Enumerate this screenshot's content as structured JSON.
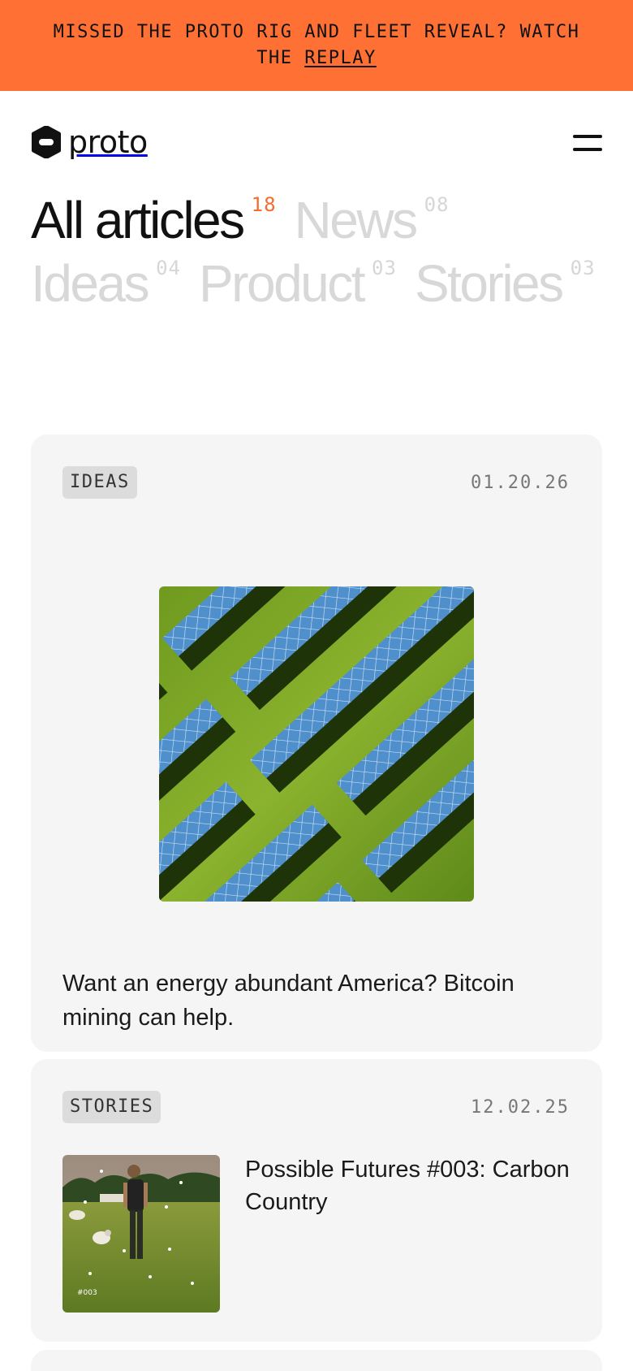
{
  "banner": {
    "text": "MISSED THE PROTO RIG AND FLEET REVEAL? WATCH THE",
    "link_label": "REPLAY"
  },
  "header": {
    "brand": "proto"
  },
  "filters": [
    {
      "label": "All articles",
      "count": "18",
      "active": true
    },
    {
      "label": "News",
      "count": "08",
      "active": false
    },
    {
      "label": "Ideas",
      "count": "04",
      "active": false
    },
    {
      "label": "Product",
      "count": "03",
      "active": false
    },
    {
      "label": "Stories",
      "count": "03",
      "active": false
    }
  ],
  "articles": [
    {
      "tag": "IDEAS",
      "date": "01.20.26",
      "title": "Want an energy abundant America? Bitcoin mining can help."
    },
    {
      "tag": "STORIES",
      "date": "12.02.25",
      "title": "Possible Futures #003: Carbon Country",
      "thumb_caption": "#003"
    }
  ],
  "colors": {
    "banner": "#ff7034",
    "accent_count": "#f06d2f",
    "inactive_filter": "#d8d8d8",
    "card_bg": "#f5f5f5"
  },
  "icons": {
    "logo": "proto-logo-icon",
    "menu": "hamburger-menu-icon"
  }
}
